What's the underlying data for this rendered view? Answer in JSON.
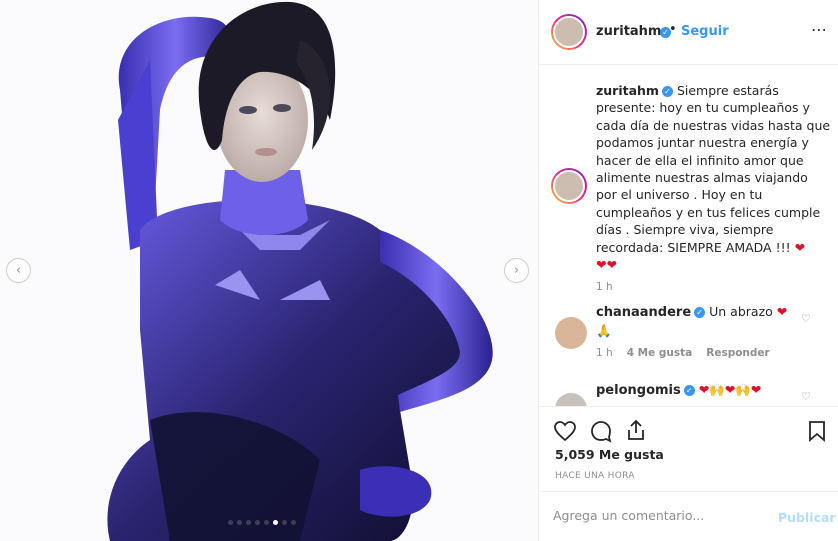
{
  "media": {
    "prev_icon": "chevron-left-icon",
    "next_icon": "chevron-right-icon",
    "dots_count": 8,
    "active_dot": 5
  },
  "post": {
    "username": "zuritahm",
    "follow_label": "Seguir",
    "separator": "•",
    "caption": "Siempre estarás presente: hoy en tu cumpleaños y cada día de nuestras vidas hasta que podamos juntar nuestra energía y hacer de ella el infinito amor que alimente nuestras almas viajando por el universo . Hoy en tu cumpleaños y en tus felices cumple días . Siempre viva, siempre recordada: SIEMPRE AMADA !!! ",
    "caption_emojis": "❤",
    "caption_emojis2": "❤❤",
    "caption_time": "1 h"
  },
  "comments": [
    {
      "username": "chanaandere",
      "text": "Un abrazo ",
      "emoji": "❤",
      "emoji2": "🙏",
      "time": "1 h",
      "likes": "4 Me gusta",
      "reply": "Responder"
    },
    {
      "username": "pelongomis",
      "emojis": "❤🙌❤🙌❤"
    }
  ],
  "actions": {
    "likes": "5,059 Me gusta",
    "timestamp": "HACE UNA HORA"
  },
  "composer": {
    "placeholder": "Agrega un comentario...",
    "post_label": "Publicar"
  },
  "colors": {
    "accent": "#3897f0",
    "heart": "#e0102b",
    "suit": "#5b4fd6"
  }
}
